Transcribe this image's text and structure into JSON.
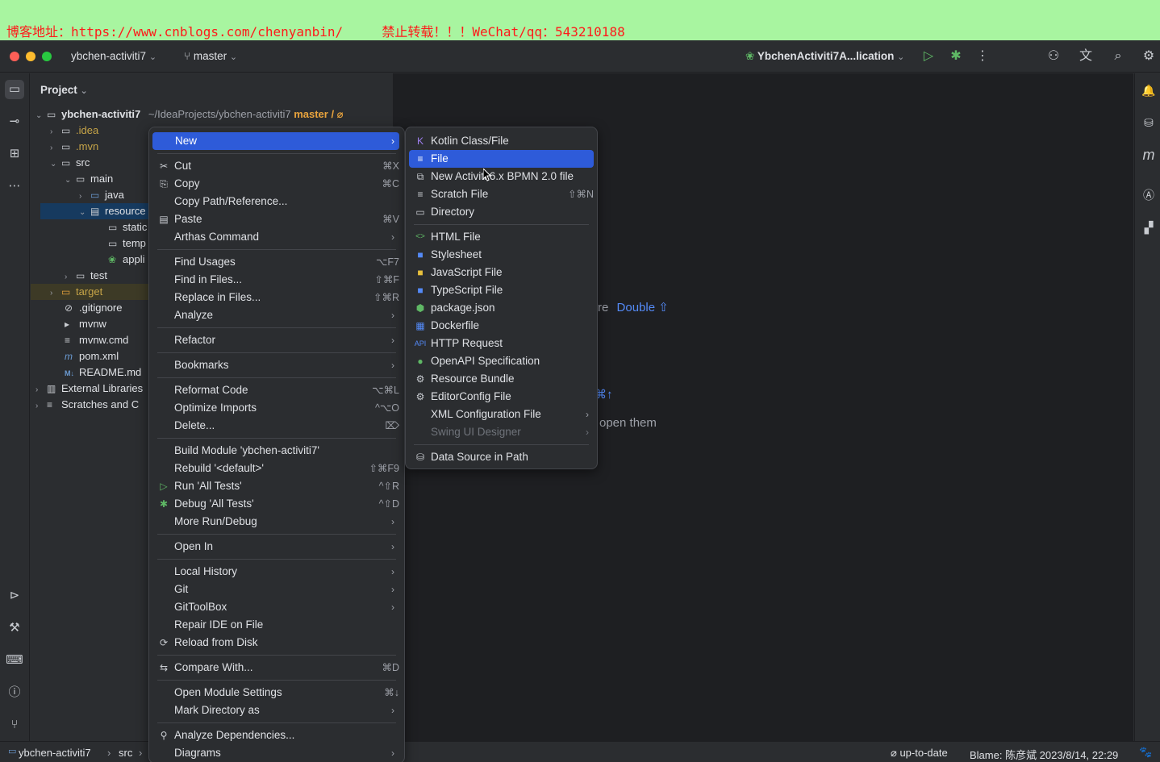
{
  "banner": {
    "text": "博客地址：https://www.cnblogs.com/chenyanbin/     禁止转载！！！WeChat/qq：543210188"
  },
  "titlebar": {
    "project": "ybchen-activiti7",
    "branch": "master",
    "run_config": "YbchenActiviti7A...lication"
  },
  "project_panel": {
    "title": "Project",
    "tree": [
      {
        "label": "ybchen-activiti7",
        "suffix": "~/IdeaProjects/ybchen-activiti7",
        "branch": "master / ⌀"
      },
      {
        "label": ".idea"
      },
      {
        "label": ".mvn"
      },
      {
        "label": "src"
      },
      {
        "label": "main"
      },
      {
        "label": "java"
      },
      {
        "label": "resource"
      },
      {
        "label": "static"
      },
      {
        "label": "temp"
      },
      {
        "label": "appli"
      },
      {
        "label": "test"
      },
      {
        "label": "target"
      },
      {
        "label": ".gitignore"
      },
      {
        "label": "mvnw"
      },
      {
        "label": "mvnw.cmd"
      },
      {
        "label": "pom.xml"
      },
      {
        "label": "README.md"
      },
      {
        "label": "External Libraries"
      },
      {
        "label": "Scratches and C"
      }
    ]
  },
  "editor_hints": {
    "hint1_a": "re",
    "hint1_b": "Double ⇧",
    "hint2": "⌘↑",
    "hint3": "open them"
  },
  "context_menu": {
    "items": [
      {
        "label": "New",
        "shortcut": "",
        "submenu": true,
        "icon": ""
      },
      {
        "label": "Cut",
        "shortcut": "⌘X",
        "icon": "✂"
      },
      {
        "label": "Copy",
        "shortcut": "⌘C",
        "icon": "⎘"
      },
      {
        "label": "Copy Path/Reference...",
        "shortcut": "",
        "icon": ""
      },
      {
        "label": "Paste",
        "shortcut": "⌘V",
        "icon": "📋"
      },
      {
        "label": "Arthas Command",
        "submenu": true
      },
      {
        "label": "Find Usages",
        "shortcut": "⌥F7"
      },
      {
        "label": "Find in Files...",
        "shortcut": "⇧⌘F"
      },
      {
        "label": "Replace in Files...",
        "shortcut": "⇧⌘R"
      },
      {
        "label": "Analyze",
        "submenu": true
      },
      {
        "label": "Refactor",
        "submenu": true
      },
      {
        "label": "Bookmarks",
        "submenu": true
      },
      {
        "label": "Reformat Code",
        "shortcut": "⌥⌘L"
      },
      {
        "label": "Optimize Imports",
        "shortcut": "^⌥O"
      },
      {
        "label": "Delete...",
        "shortcut": "⌦"
      },
      {
        "label": "Build Module 'ybchen-activiti7'",
        "shortcut": ""
      },
      {
        "label": "Rebuild '<default>'",
        "shortcut": "⇧⌘F9"
      },
      {
        "label": "Run 'All Tests'",
        "shortcut": "^⇧R",
        "icon": "▶"
      },
      {
        "label": "Debug 'All Tests'",
        "shortcut": "^⇧D",
        "icon": "🐞"
      },
      {
        "label": "More Run/Debug",
        "submenu": true
      },
      {
        "label": "Open In",
        "submenu": true
      },
      {
        "label": "Local History",
        "submenu": true
      },
      {
        "label": "Git",
        "submenu": true
      },
      {
        "label": "GitToolBox",
        "submenu": true
      },
      {
        "label": "Repair IDE on File"
      },
      {
        "label": "Reload from Disk",
        "icon": "⟳"
      },
      {
        "label": "Compare With...",
        "shortcut": "⌘D",
        "icon": "⇆"
      },
      {
        "label": "Open Module Settings",
        "shortcut": "⌘↓"
      },
      {
        "label": "Mark Directory as",
        "submenu": true
      },
      {
        "label": "Analyze Dependencies...",
        "icon": "⚲"
      },
      {
        "label": "Diagrams",
        "submenu": true
      }
    ]
  },
  "new_submenu": {
    "items": [
      {
        "label": "Kotlin Class/File",
        "icon": "K"
      },
      {
        "label": "File",
        "icon": "≡"
      },
      {
        "label": "New Activiti 6.x BPMN 2.0 file",
        "icon": "⧉"
      },
      {
        "label": "Scratch File",
        "shortcut": "⇧⌘N",
        "icon": "≡"
      },
      {
        "label": "Directory",
        "icon": "▭"
      },
      {
        "label": "HTML File",
        "icon": "<>"
      },
      {
        "label": "Stylesheet",
        "icon": "3"
      },
      {
        "label": "JavaScript File",
        "icon": "JS"
      },
      {
        "label": "TypeScript File",
        "icon": "TS"
      },
      {
        "label": "package.json",
        "icon": "⬢"
      },
      {
        "label": "Dockerfile",
        "icon": "▦"
      },
      {
        "label": "HTTP Request",
        "icon": "API"
      },
      {
        "label": "OpenAPI Specification",
        "icon": "●"
      },
      {
        "label": "Resource Bundle",
        "icon": "⚙"
      },
      {
        "label": "EditorConfig File",
        "icon": "⚙"
      },
      {
        "label": "XML Configuration File",
        "submenu": true
      },
      {
        "label": "Swing UI Designer",
        "submenu": true
      },
      {
        "label": "Data Source in Path",
        "icon": "⛁"
      }
    ]
  },
  "statusbar": {
    "breadcrumb_project": "ybchen-activiti7",
    "breadcrumb_src": "src",
    "vcs": "⌀ up-to-date",
    "blame": "Blame: 陈彦斌 2023/8/14, 22:29"
  }
}
